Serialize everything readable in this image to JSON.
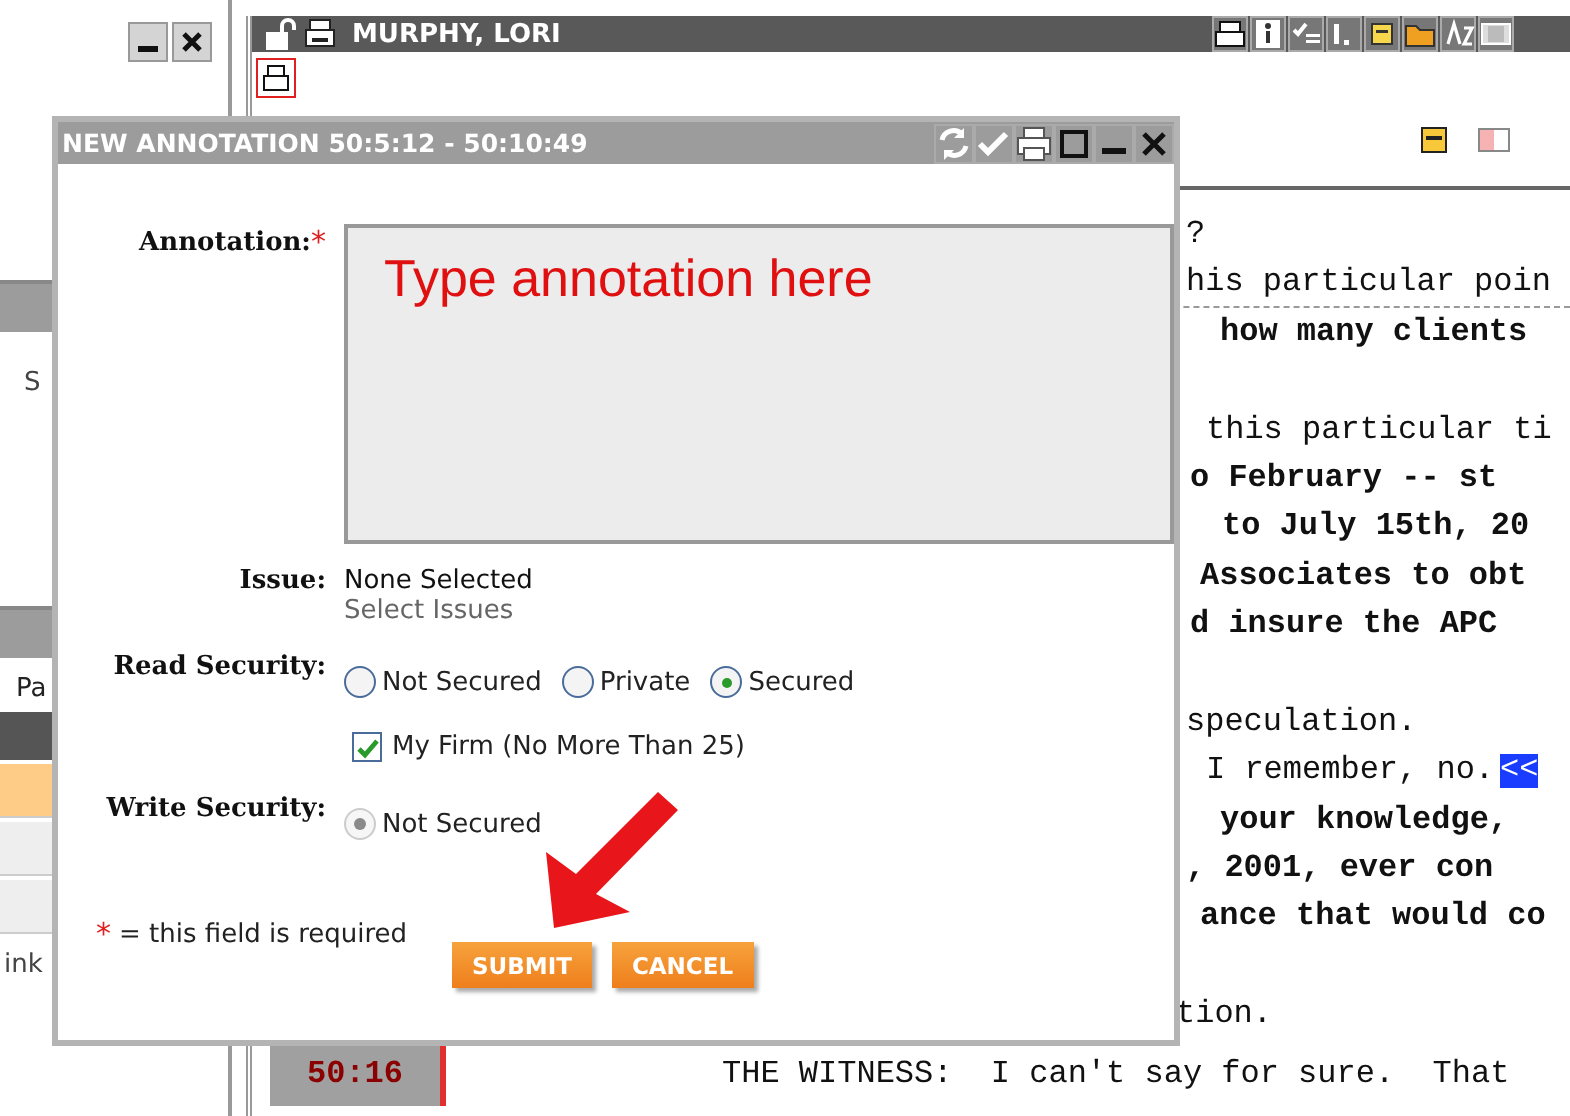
{
  "left_panel": {
    "label_1": "S",
    "label_2": "Pa",
    "footer": "ink",
    "rows": [
      {
        "selected": true
      },
      {
        "selected": false
      },
      {
        "selected": false
      }
    ]
  },
  "main": {
    "title": "MURPHY, LORI",
    "transcript": [
      {
        "text": "?",
        "bold": false
      },
      {
        "text": "his particular poin",
        "bold": false
      },
      {
        "text": "how many clients",
        "bold": true
      },
      {
        "text": "this particular ti",
        "bold": false
      },
      {
        "text": "o February -- st",
        "bold": true
      },
      {
        "text": "to July 15th, 20",
        "bold": true
      },
      {
        "text": "Associates to obt",
        "bold": true
      },
      {
        "text": "d insure the APC",
        "bold": true
      },
      {
        "text": "speculation.",
        "bold": false
      },
      {
        "text": "I remember, no.",
        "bold": false,
        "highlight": "<<"
      },
      {
        "text": "your knowledge,",
        "bold": true
      },
      {
        "text": ", 2001, ever con",
        "bold": true
      },
      {
        "text": "ance that would co",
        "bold": true
      },
      {
        "text": "tion.",
        "bold": false
      },
      {
        "text": "THE WITNESS:  I can't say for sure.  That",
        "bold": false,
        "timestamp": "50:16"
      }
    ]
  },
  "dialog": {
    "title": "NEW ANNOTATION 50:5:12 - 50:10:49",
    "annotation": {
      "label": "Annotation:",
      "required_mark": "*",
      "placeholder": "Type annotation here"
    },
    "issue": {
      "label": "Issue:",
      "value": "None Selected",
      "link": "Select Issues"
    },
    "read_security": {
      "label": "Read Security:",
      "options": [
        {
          "label": "Not Secured",
          "selected": false
        },
        {
          "label": "Private",
          "selected": false
        },
        {
          "label": "Secured",
          "selected": true
        }
      ],
      "checkbox": {
        "label": "My Firm (No More Than 25)",
        "checked": true
      }
    },
    "write_security": {
      "label": "Write Security:",
      "options": [
        {
          "label": "Not Secured",
          "selected": true,
          "disabled": true
        }
      ]
    },
    "required_note": {
      "mark": "*",
      "text": "= this field is required"
    },
    "buttons": [
      "SUBMIT",
      "CANCEL"
    ]
  }
}
